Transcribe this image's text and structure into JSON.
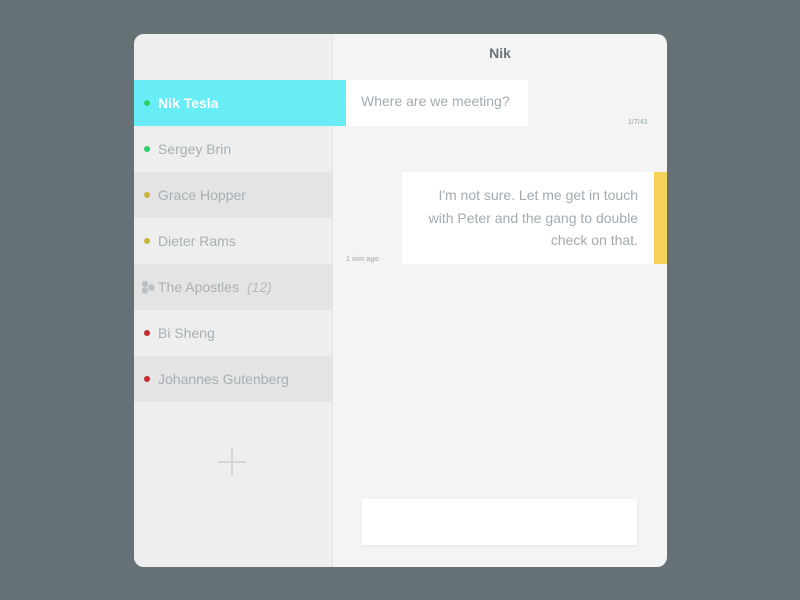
{
  "chat": {
    "title": "Nik"
  },
  "contacts": [
    {
      "name": "Nik Tesla",
      "status": "online",
      "status_color": "#2fd06a",
      "active": true
    },
    {
      "name": "Sergey Brin",
      "status": "online",
      "status_color": "#2fd06a"
    },
    {
      "name": "Grace Hopper",
      "status": "away",
      "status_color": "#c8b43a"
    },
    {
      "name": "Dieter Rams",
      "status": "away",
      "status_color": "#c8b43a"
    },
    {
      "name": "The Apostles",
      "type": "group",
      "count": "(12)",
      "icon": "group-icon"
    },
    {
      "name": "Bi Sheng",
      "status": "busy",
      "status_color": "#c62a2a"
    },
    {
      "name": "Johannes Gutenberg",
      "status": "busy",
      "status_color": "#c62a2a"
    }
  ],
  "add_contact": {
    "icon": "plus-icon"
  },
  "messages": [
    {
      "direction": "incoming",
      "text": "Where are we meeting?",
      "time": "1/7/43"
    },
    {
      "direction": "outgoing",
      "lines": [
        "I'm not sure. Let me get in touch",
        "with Peter and the gang to double",
        "check on that."
      ],
      "time": "1 min ago",
      "accent_color": "#f5d25c"
    }
  ],
  "composer": {
    "value": "",
    "placeholder": ""
  },
  "colors": {
    "active_contact": "#68ecf5",
    "background": "#667176"
  }
}
